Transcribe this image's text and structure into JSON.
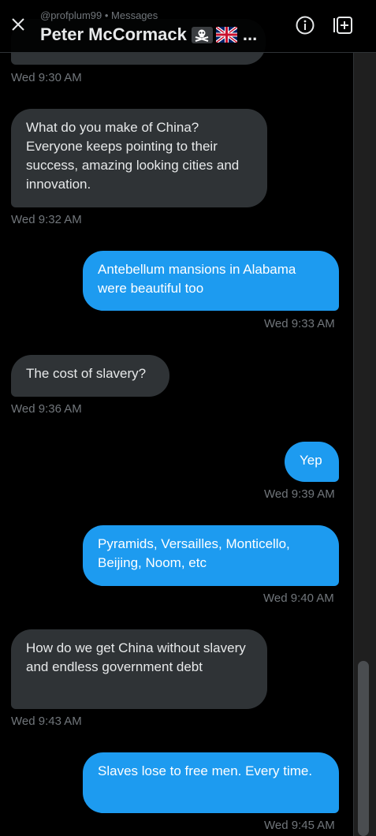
{
  "header": {
    "subtitle": "@profplum99 • Messages",
    "title": "Peter McCormack",
    "ellipsis": "..."
  },
  "messages": [
    {
      "dir": "in",
      "text": "",
      "time": "Wed 9:30 AM"
    },
    {
      "dir": "in",
      "text": "What do you make of China? Everyone keeps pointing to their success, amazing looking cities and innovation.",
      "time": "Wed 9:32 AM"
    },
    {
      "dir": "out",
      "text": "Antebellum mansions in Alabama were beautiful too",
      "time": "Wed 9:33 AM"
    },
    {
      "dir": "in",
      "text": "The cost of slavery?",
      "time": "Wed 9:36 AM"
    },
    {
      "dir": "out",
      "text": "Yep",
      "time": "Wed 9:39 AM"
    },
    {
      "dir": "out",
      "text": "Pyramids, Versailles, Monticello, Beijing, Noom, etc",
      "time": "Wed 9:40 AM"
    },
    {
      "dir": "in",
      "text": "How do we get China without slavery and endless government debt",
      "time": "Wed 9:43 AM"
    },
    {
      "dir": "out",
      "text": "Slaves lose to free men. Every time.",
      "time": "Wed 9:45 AM"
    }
  ],
  "colors": {
    "background": "#000000",
    "incoming_bubble": "#2f3336",
    "outgoing_bubble": "#1d9bf0",
    "timestamp": "#71767b"
  },
  "icons": [
    "close-icon",
    "pirate-flag-icon",
    "uk-flag-icon",
    "info-icon",
    "add-to-group-icon"
  ]
}
